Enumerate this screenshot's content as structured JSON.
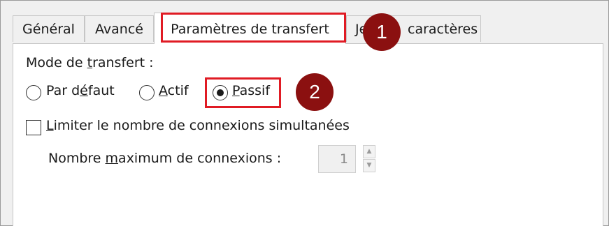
{
  "tabs": [
    {
      "label": "Général",
      "selected": false
    },
    {
      "label": "Avancé",
      "selected": false
    },
    {
      "label": "Paramètres de transfert",
      "selected": true
    },
    {
      "label": "Je",
      "selected": false
    },
    {
      "label": "caractères",
      "selected": false
    }
  ],
  "transfer_mode": {
    "label_pre": "Mode de ",
    "label_u": "t",
    "label_post": "ransfert :",
    "options": [
      {
        "pre": "Par d",
        "u": "é",
        "post": "faut",
        "checked": false
      },
      {
        "pre": "",
        "u": "A",
        "post": "ctif",
        "checked": false
      },
      {
        "pre": "",
        "u": "P",
        "post": "assif",
        "checked": true
      }
    ]
  },
  "limit": {
    "u": "L",
    "post": "imiter le nombre de connexions simultanées",
    "checked": false
  },
  "max_connections": {
    "label_pre": "Nombre ",
    "label_u": "m",
    "label_post": "aximum de connexions :",
    "value": "1"
  },
  "markers": [
    "1",
    "2"
  ],
  "colors": {
    "highlight": "#e01b24",
    "marker": "#8b1010"
  }
}
